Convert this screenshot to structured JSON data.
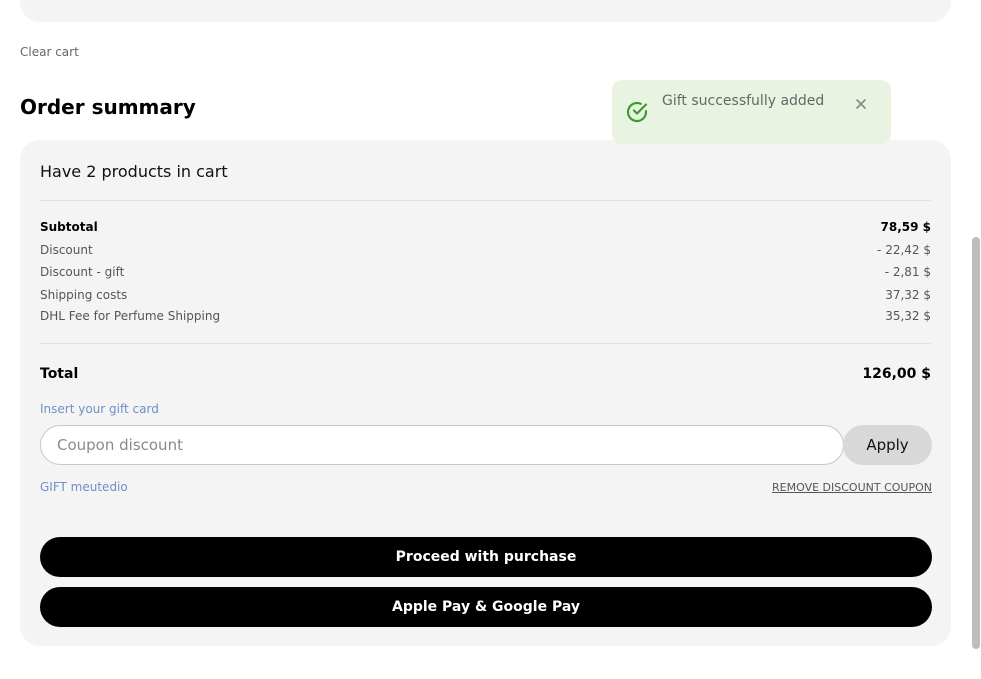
{
  "cart": {
    "clear_label": "Clear cart"
  },
  "summary": {
    "title": "Order summary",
    "products_count": "Have 2 products in cart",
    "lines": [
      {
        "label": "Subtotal",
        "value": "78,59 $"
      },
      {
        "label": "Discount",
        "value": "- 22,42 $"
      },
      {
        "label": "Discount - gift",
        "value": "- 2,81 $"
      },
      {
        "label": "Shipping costs",
        "value": "37,32 $"
      },
      {
        "label": "DHL Fee for Perfume Shipping",
        "value": "35,32 $"
      }
    ],
    "total": {
      "label": "Total",
      "value": "126,00 $"
    },
    "gift_card_label": "Insert your gift card",
    "coupon_placeholder": "Coupon discount",
    "apply_label": "Apply",
    "applied_code": "GIFT meutedio",
    "remove_coupon_label": "REMOVE DISCOUNT COUPON",
    "proceed_label": "Proceed with purchase",
    "wallet_pay_label": "Apple Pay & Google Pay"
  },
  "toast": {
    "message": "Gift successfully added",
    "icon": "check-circle-icon",
    "close_icon": "close-icon",
    "accent_color": "#3c9a2e"
  }
}
